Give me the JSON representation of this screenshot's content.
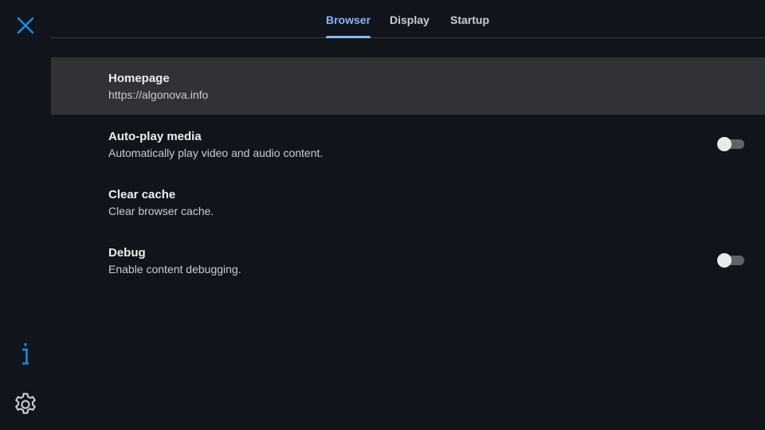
{
  "colors": {
    "background": "#12141b",
    "accent": "#8ab4f8",
    "icon_blue": "#1e88e5",
    "selected_row": "#303236"
  },
  "rail": {
    "close_icon": "close-icon",
    "info_icon": "info-icon",
    "settings_icon": "gear-icon"
  },
  "tabs": [
    {
      "label": "Browser",
      "active": true
    },
    {
      "label": "Display",
      "active": false
    },
    {
      "label": "Startup",
      "active": false
    }
  ],
  "settings": [
    {
      "title": "Homepage",
      "subtitle": "https://algonova.info",
      "selected": true
    },
    {
      "title": "Auto-play media",
      "subtitle": "Automatically play video and audio content.",
      "toggle": false
    },
    {
      "title": "Clear cache",
      "subtitle": "Clear browser cache."
    },
    {
      "title": "Debug",
      "subtitle": "Enable content debugging.",
      "toggle": false
    }
  ]
}
